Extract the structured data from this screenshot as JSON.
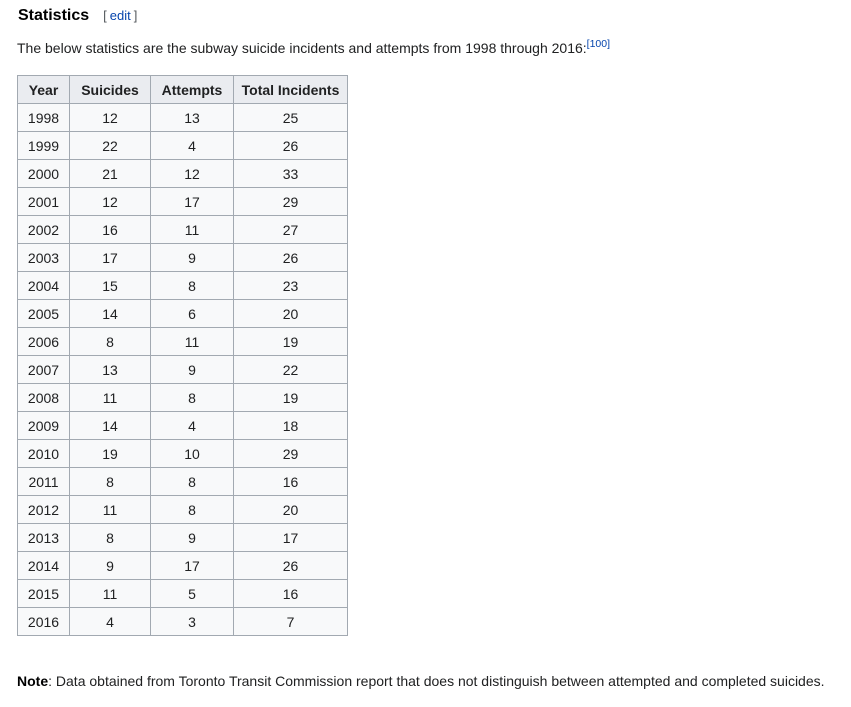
{
  "heading": {
    "title": "Statistics",
    "edit_open": "[",
    "edit_label": "edit",
    "edit_close": "]"
  },
  "intro": {
    "text": "The below statistics are the subway suicide incidents and attempts from 1998 through 2016:",
    "citation": "[100]"
  },
  "table": {
    "headers": [
      "Year",
      "Suicides",
      "Attempts",
      "Total Incidents"
    ],
    "rows": [
      [
        "1998",
        "12",
        "13",
        "25"
      ],
      [
        "1999",
        "22",
        "4",
        "26"
      ],
      [
        "2000",
        "21",
        "12",
        "33"
      ],
      [
        "2001",
        "12",
        "17",
        "29"
      ],
      [
        "2002",
        "16",
        "11",
        "27"
      ],
      [
        "2003",
        "17",
        "9",
        "26"
      ],
      [
        "2004",
        "15",
        "8",
        "23"
      ],
      [
        "2005",
        "14",
        "6",
        "20"
      ],
      [
        "2006",
        "8",
        "11",
        "19"
      ],
      [
        "2007",
        "13",
        "9",
        "22"
      ],
      [
        "2008",
        "11",
        "8",
        "19"
      ],
      [
        "2009",
        "14",
        "4",
        "18"
      ],
      [
        "2010",
        "19",
        "10",
        "29"
      ],
      [
        "2011",
        "8",
        "8",
        "16"
      ],
      [
        "2012",
        "11",
        "8",
        "20"
      ],
      [
        "2013",
        "8",
        "9",
        "17"
      ],
      [
        "2014",
        "9",
        "17",
        "26"
      ],
      [
        "2015",
        "11",
        "5",
        "16"
      ],
      [
        "2016",
        "4",
        "3",
        "7"
      ]
    ]
  },
  "note": {
    "label": "Note",
    "text": ": Data obtained from Toronto Transit Commission report that does not distinguish between attempted and completed suicides."
  },
  "colors": {
    "link": "#0645ad",
    "text": "#202122",
    "header_bg": "#eaecf0",
    "cell_bg": "#f8f9fa",
    "border": "#a2a9b1"
  }
}
